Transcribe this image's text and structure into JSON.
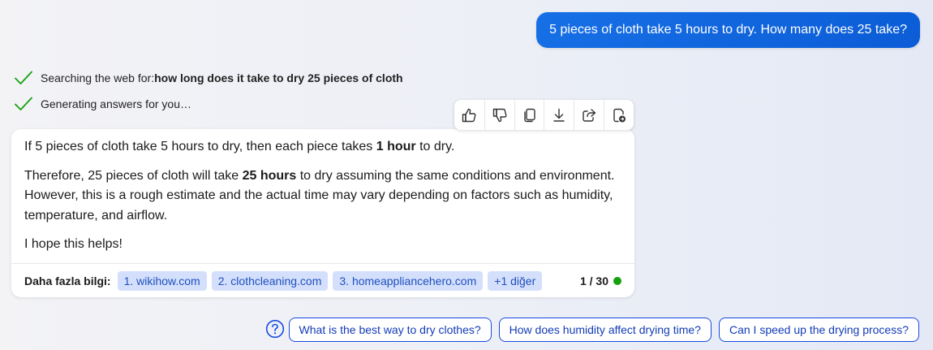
{
  "user_message": "5 pieces of cloth take 5 hours to dry. How many does 25 take?",
  "status": [
    {
      "icon": "check-icon",
      "text": "Searching the web for: ",
      "bold": "how long does it take to dry 25 pieces of cloth"
    },
    {
      "icon": "check-icon",
      "text": "Generating answers for you…",
      "bold": ""
    }
  ],
  "toolbar": {
    "buttons": [
      "thumbs-up-icon",
      "thumbs-down-icon",
      "copy-icon",
      "download-icon",
      "share-icon",
      "export-icon"
    ]
  },
  "answer": {
    "p1_a": "If 5 pieces of cloth take 5 hours to dry, then each piece takes ",
    "p1_b": "1 hour",
    "p1_c": " to dry.",
    "p2_a": "Therefore, 25 pieces of cloth will take ",
    "p2_b": "25 hours",
    "p2_c": " to dry assuming the same conditions and environment. However, this is a rough estimate and the actual time may vary depending on factors such as humidity, temperature, and airflow.",
    "p3": "I hope this helps!"
  },
  "footer": {
    "learn_more_label": "Daha fazla bilgi:",
    "sources": [
      "1. wikihow.com",
      "2. clothcleaning.com",
      "3. homeappliancehero.com",
      "+1 diğer"
    ],
    "counter": "1 / 30",
    "status_color": "#13a10e"
  },
  "suggestions": [
    "What is the best way to dry clothes?",
    "How does humidity affect drying time?",
    "Can I speed up the drying process?"
  ],
  "colors": {
    "accent": "#0b5cd6",
    "chip_bg": "#d4e0fb",
    "suggestion_border": "#174ae4"
  }
}
